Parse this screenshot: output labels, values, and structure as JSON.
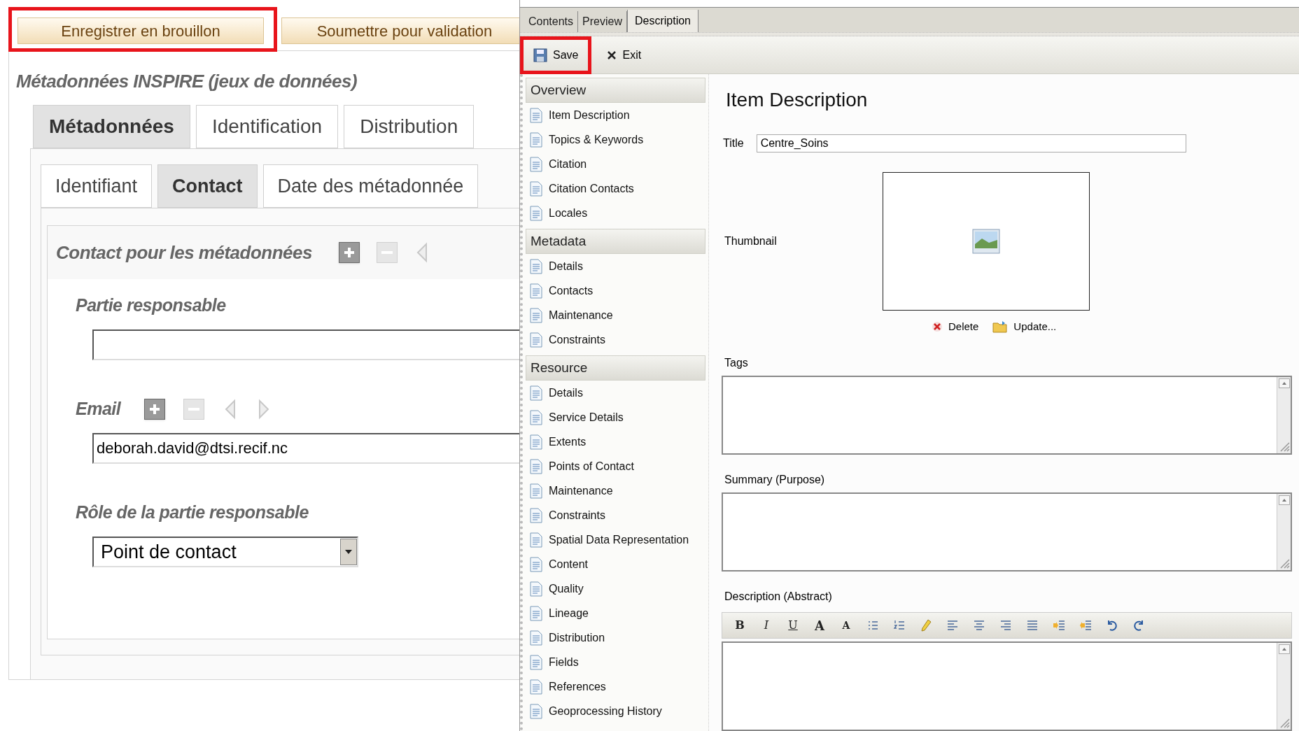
{
  "left_panel": {
    "actions": [
      {
        "label": "Enregistrer en brouillon",
        "highlighted": true
      },
      {
        "label": "Soumettre pour validation",
        "highlighted": false
      }
    ],
    "title": "Métadonnées INSPIRE (jeux de données)",
    "tabs": [
      {
        "label": "Métadonnées",
        "selected": true
      },
      {
        "label": "Identification",
        "selected": false
      },
      {
        "label": "Distribution",
        "selected": false
      }
    ],
    "subtabs": [
      {
        "label": "Identifiant",
        "selected": false
      },
      {
        "label": "Contact",
        "selected": true
      },
      {
        "label": "Date des métadonnée",
        "selected": false
      }
    ],
    "section": {
      "title": "Contact pour les métadonnées",
      "controls": [
        {
          "kind": "add",
          "disabled": false
        },
        {
          "kind": "remove",
          "disabled": true
        },
        {
          "kind": "previous",
          "disabled": true
        }
      ]
    },
    "fields": [
      {
        "kind": "text",
        "label": "Partie responsable"
      },
      {
        "kind": "text",
        "label": "Email",
        "value": "deborah.david@dtsi.recif.nc",
        "controls": [
          {
            "kind": "add",
            "disabled": false
          },
          {
            "kind": "remove",
            "disabled": true
          },
          {
            "kind": "previous",
            "disabled": true
          },
          {
            "kind": "next",
            "disabled": true
          }
        ]
      },
      {
        "kind": "select",
        "label": "Rôle de la partie responsable",
        "value": "Point de contact"
      }
    ]
  },
  "editor": {
    "tabs": [
      {
        "label": "Contents",
        "selected": false
      },
      {
        "label": "Preview",
        "selected": false
      },
      {
        "label": "Description",
        "selected": true
      }
    ],
    "toolbar": [
      {
        "kind": "save",
        "label": "Save",
        "highlighted": true
      },
      {
        "kind": "exit",
        "label": "Exit",
        "highlighted": false
      }
    ],
    "sidebar": [
      {
        "title": "Overview",
        "items": [
          "Item Description",
          "Topics & Keywords",
          "Citation",
          "Citation Contacts",
          "Locales"
        ]
      },
      {
        "title": "Metadata",
        "items": [
          "Details",
          "Contacts",
          "Maintenance",
          "Constraints"
        ]
      },
      {
        "title": "Resource",
        "items": [
          "Details",
          "Service Details",
          "Extents",
          "Points of Contact",
          "Maintenance",
          "Constraints",
          "Spatial Data Representation",
          "Content",
          "Quality",
          "Lineage",
          "Distribution",
          "Fields",
          "References",
          "Geoprocessing History"
        ]
      }
    ],
    "content": {
      "heading": "Item Description",
      "title_label": "Title",
      "title_value": "Centre_Soins",
      "thumbnail_label": "Thumbnail",
      "thumbnail_actions": [
        {
          "kind": "delete",
          "label": "Delete"
        },
        {
          "kind": "update",
          "label": "Update..."
        }
      ],
      "tags_label": "Tags",
      "summary_label": "Summary (Purpose)",
      "description_label": "Description (Abstract)",
      "format_toolbar": [
        {
          "kind": "bold",
          "label": "B"
        },
        {
          "kind": "italic",
          "label": "I"
        },
        {
          "kind": "underline",
          "label": "U"
        },
        {
          "kind": "grow",
          "label": "A"
        },
        {
          "kind": "shrink",
          "label": "A"
        },
        {
          "kind": "bullets"
        },
        {
          "kind": "numbers"
        },
        {
          "kind": "highlight"
        },
        {
          "kind": "align_left"
        },
        {
          "kind": "align_center"
        },
        {
          "kind": "align_right"
        },
        {
          "kind": "justify"
        },
        {
          "kind": "indent"
        },
        {
          "kind": "outdent"
        },
        {
          "kind": "undo"
        },
        {
          "kind": "redo"
        }
      ]
    }
  }
}
